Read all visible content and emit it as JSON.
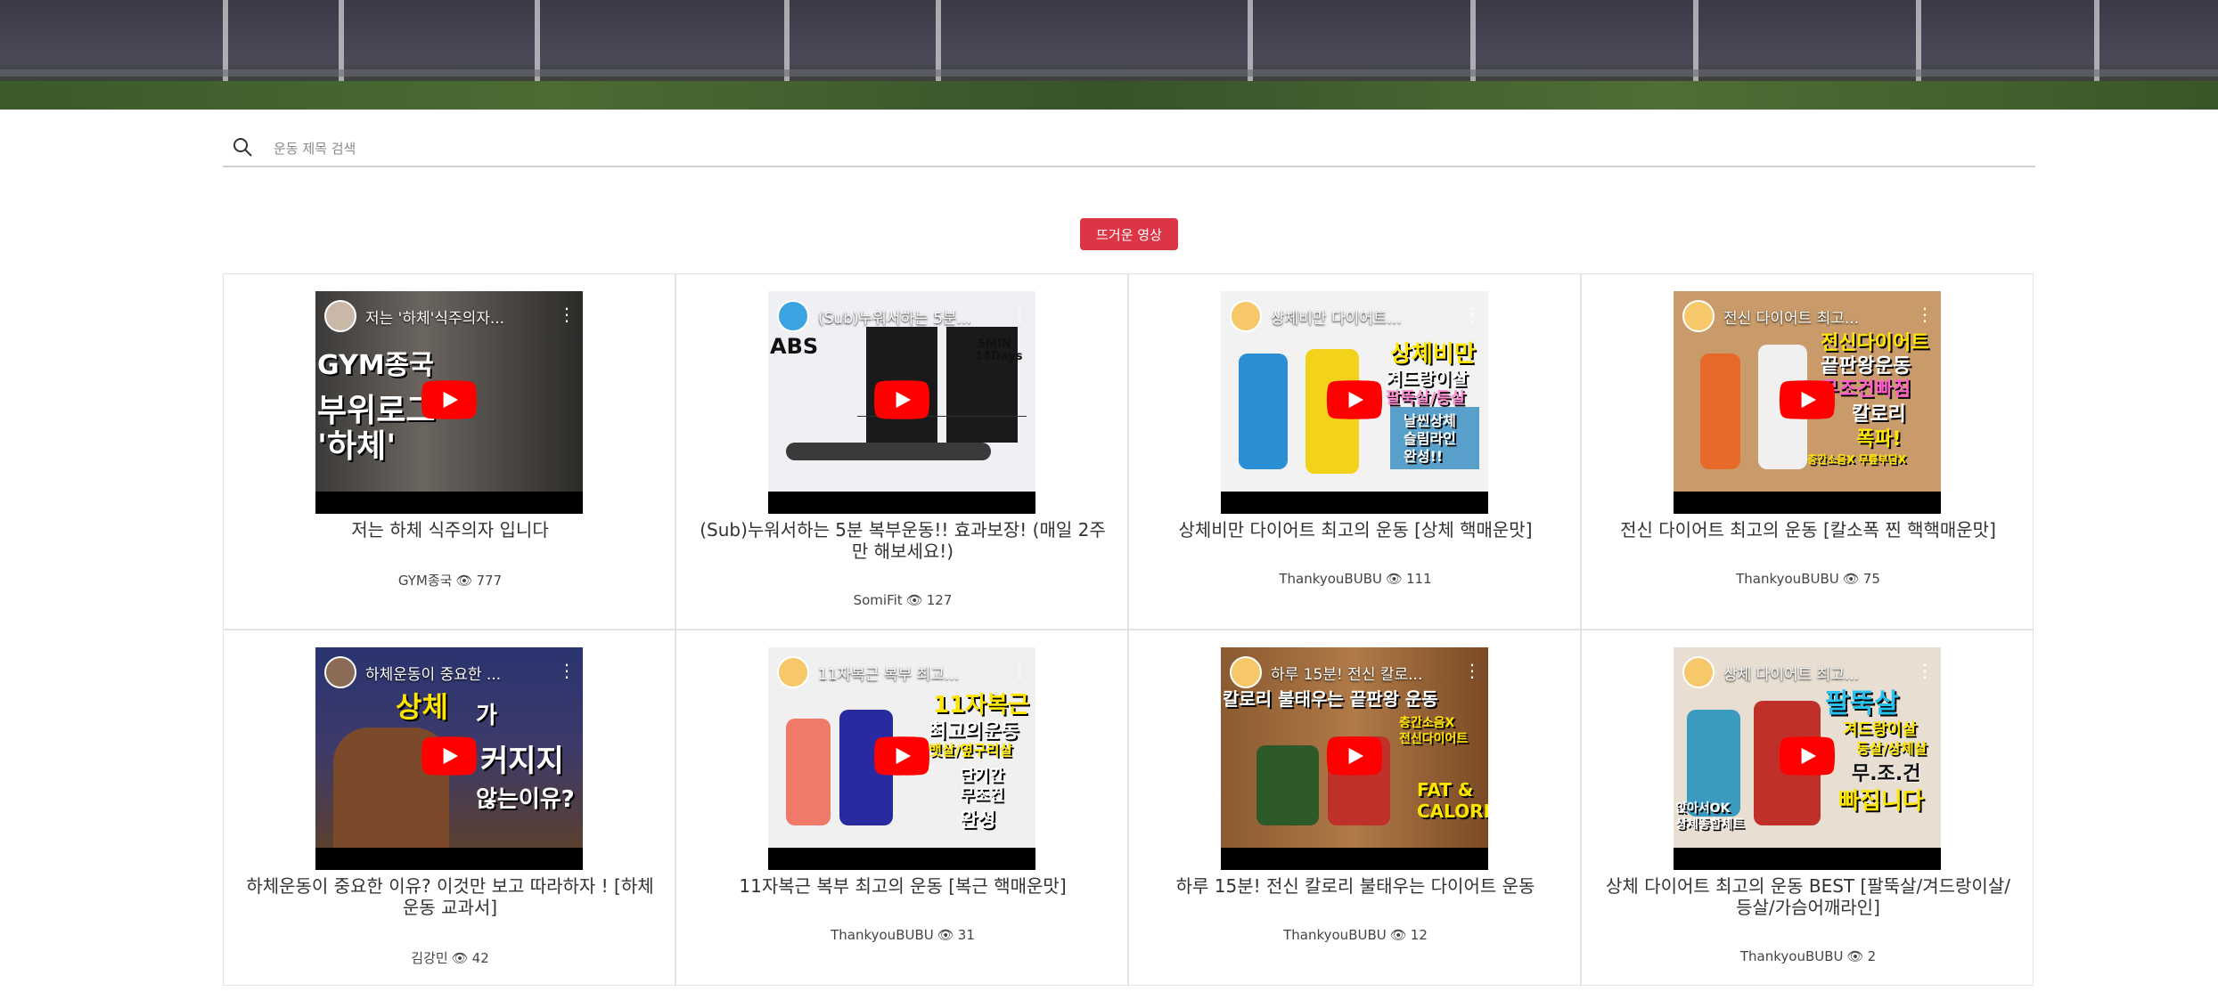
{
  "search": {
    "placeholder": "운동 제목 검색"
  },
  "hot_button": "뜨거운 영상",
  "videos": [
    {
      "thumb_title": "저는 '하체'식주의자...",
      "title": "저는 하체 식주의자 입니다",
      "channel": "GYM종국",
      "views": "777",
      "overlay": [
        "GYM종국",
        "부위로그",
        "'하체'"
      ]
    },
    {
      "thumb_title": "(Sub)누워서하는 5분...",
      "title": "(Sub)누워서하는 5분 복부운동!! 효과보장! (매일 2주만 해보세요!)",
      "channel": "SomiFit",
      "views": "127",
      "overlay": [
        "ABS",
        "5MIN",
        "14Days"
      ]
    },
    {
      "thumb_title": "상체비만 다이어트...",
      "title": "상체비만 다이어트 최고의 운동 [상체 핵매운맛]",
      "channel": "ThankyouBUBU",
      "views": "111",
      "overlay": [
        "상체비만",
        "겨드랑이살",
        "팔뚝살/등살",
        "날씬상체",
        "슬림라인",
        "완성!!"
      ]
    },
    {
      "thumb_title": "전신 다이어트 최고...",
      "title": "전신 다이어트 최고의 운동 [칼소폭 찐 핵핵매운맛]",
      "channel": "ThankyouBUBU",
      "views": "75",
      "overlay": [
        "전신다이어트",
        "끝판왕운동",
        "무조건빠짐",
        "칼로리",
        "폭파!",
        "층간소음X 무릎부담X"
      ]
    },
    {
      "thumb_title": "하체운동이 중요한 ...",
      "title": "하체운동이 중요한 이유? 이것만 보고 따라하자 ! [하체운동 교과서]",
      "channel": "김강민",
      "views": "42",
      "overlay": [
        "상체",
        "가",
        "커지지",
        "않는이유?"
      ]
    },
    {
      "thumb_title": "11자복근 복부 최고...",
      "title": "11자복근 복부 최고의 운동 [복근 핵매운맛]",
      "channel": "ThankyouBUBU",
      "views": "31",
      "overlay": [
        "11자복근",
        "최고의운동",
        "뱃살/옆구리살",
        "단기간",
        "무조건",
        "완성"
      ]
    },
    {
      "thumb_title": "하루 15분! 전신 칼로...",
      "title": "하루 15분! 전신 칼로리 불태우는 다이어트 운동",
      "channel": "ThankyouBUBU",
      "views": "12",
      "overlay": [
        "칼로리 불태우는 끝판왕 운동",
        "층간소음X",
        "전신다이어트",
        "FAT &",
        "CALORIE"
      ]
    },
    {
      "thumb_title": "상체 다이어트 최고...",
      "title": "상체 다이어트 최고의 운동 BEST [팔뚝살/겨드랑이살/등살/가슴어깨라인]",
      "channel": "ThankyouBUBU",
      "views": "2",
      "overlay": [
        "팔뚝살",
        "겨드랑이살",
        "등살/상체살",
        "무.조.건",
        "빠집니다",
        "앉아서OK",
        "상체종합세트"
      ]
    }
  ],
  "colors": {
    "accent": "#dc3545",
    "yt_red": "#ff0000"
  }
}
